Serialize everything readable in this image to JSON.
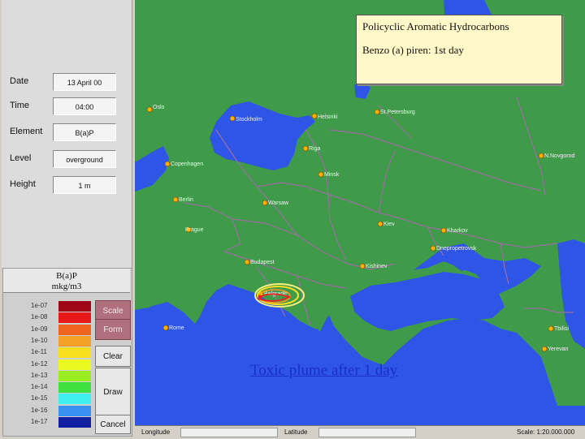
{
  "params": [
    {
      "label": "Date",
      "value": "13 April 00"
    },
    {
      "label": "Time",
      "value": "04:00"
    },
    {
      "label": "Element",
      "value": "B(a)P"
    },
    {
      "label": "Level",
      "value": "overground"
    },
    {
      "label": "Height",
      "value": "1 m"
    }
  ],
  "legend": {
    "title_line1": "B(a)P",
    "title_line2": "mkg/m3",
    "items": [
      {
        "label": "1e-07",
        "color": "#a00818"
      },
      {
        "label": "1e-08",
        "color": "#e81818"
      },
      {
        "label": "1e-09",
        "color": "#f06420"
      },
      {
        "label": "1e-10",
        "color": "#f4a028"
      },
      {
        "label": "1e-11",
        "color": "#f8e020"
      },
      {
        "label": "1e-12",
        "color": "#e8f820"
      },
      {
        "label": "1e-13",
        "color": "#98ec20"
      },
      {
        "label": "1e-14",
        "color": "#40e040"
      },
      {
        "label": "1e-15",
        "color": "#40f0f0"
      },
      {
        "label": "1e-16",
        "color": "#3890f0"
      },
      {
        "label": "1e-17",
        "color": "#1020a0"
      }
    ]
  },
  "buttons": {
    "scale": "Scale",
    "form": "Form",
    "clear": "Clear",
    "draw": "Draw",
    "cancel": "Cancel"
  },
  "info": {
    "line1": "Policyclic Aromatic Hydrocarbons",
    "line2": "Benzo (a) piren:  1st day"
  },
  "caption": "Toxic plume after 1 day",
  "cities": {
    "oslo": "Oslo",
    "stockholm": "Stockholm",
    "helsinki": "Helsinki",
    "stpetersburg": "St.Petersburg",
    "riga": "Riga",
    "copenhagen": "Copenhagen",
    "minsk": "Minsk",
    "berlin": "Berlin",
    "warsaw": "Warsaw",
    "prague": "Prague",
    "kiev": "Kiev",
    "kharkov": "Kharkov",
    "dnepropetrovsk": "Dnepropetrovsk",
    "budapest": "Budapest",
    "kishinev": "Kishinev",
    "belgrade": "Belgrade",
    "rome": "Rome",
    "nnovgorod": "N.Novgorod",
    "tbilisi": "Tbilisi",
    "yerevan": "Yerevan"
  },
  "status": {
    "longitude": "Longitude",
    "latitude": "Latitude",
    "scale": "Scale:  1:20.000.000"
  },
  "colors": {
    "sea": "#2f55e6",
    "land": "#3f9a4a",
    "borders": "#9a6fa0",
    "plume": "#e82020"
  }
}
